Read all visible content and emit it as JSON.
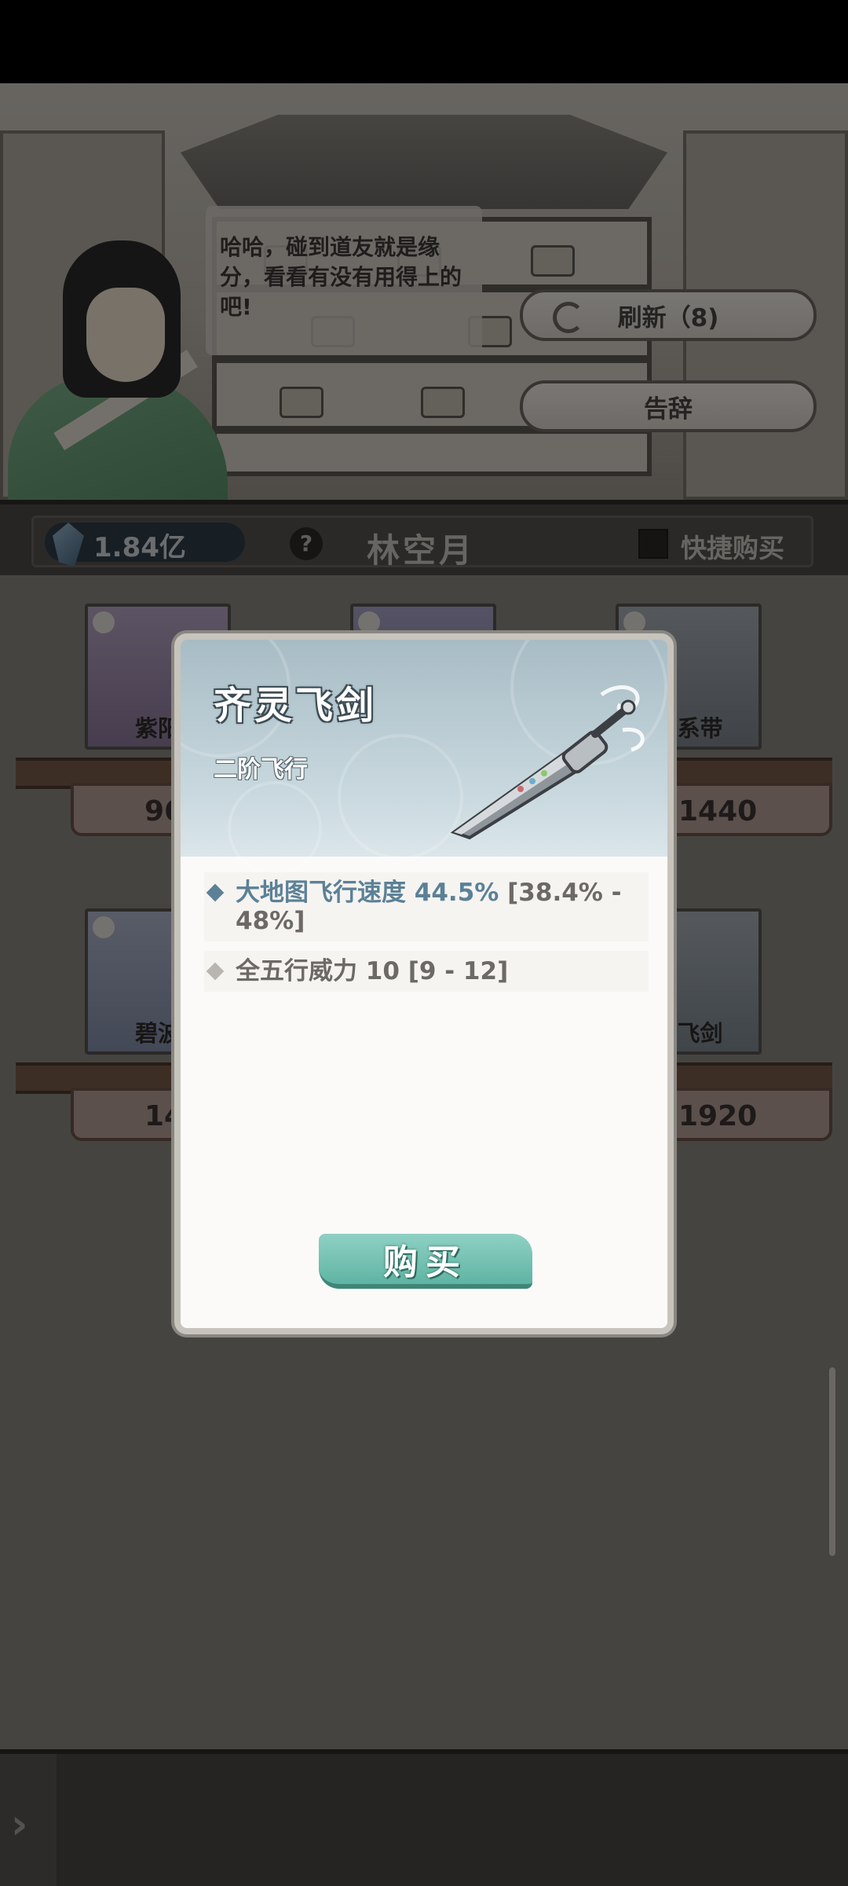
{
  "shop": {
    "speech": "哈哈，碰到道友就是缘分，看看有没有用得上的吧!",
    "refresh_label": "刷新（8)",
    "leave_label": "告辞"
  },
  "info_bar": {
    "currency": "1.84亿",
    "help": "?",
    "npc_name": "林空月",
    "quick_buy_label": "快捷购买"
  },
  "slots": [
    {
      "label": "紫阳",
      "price": "96"
    },
    {
      "label": "",
      "price": ""
    },
    {
      "label": "天系带",
      "price": "1440"
    },
    {
      "label": "碧波",
      "price": "14"
    },
    {
      "label": "",
      "price": ""
    },
    {
      "label": "灵飞剑",
      "price": "1920"
    }
  ],
  "dialog": {
    "item_name": "齐灵飞剑",
    "tier": "二阶飞行",
    "attributes": [
      {
        "name": "大地图飞行速度 44.5%",
        "range": "[38.4% - 48%]"
      },
      {
        "name": "全五行威力 10",
        "range": "[9 - 12]"
      }
    ],
    "buy_label": "购买"
  },
  "bottom_bar": {
    "expand_icon": "›"
  },
  "colors": {
    "buy_button": "#5fb4a3",
    "attr_highlight": "#5b8197",
    "dialog_header": "#a8bcc5"
  }
}
